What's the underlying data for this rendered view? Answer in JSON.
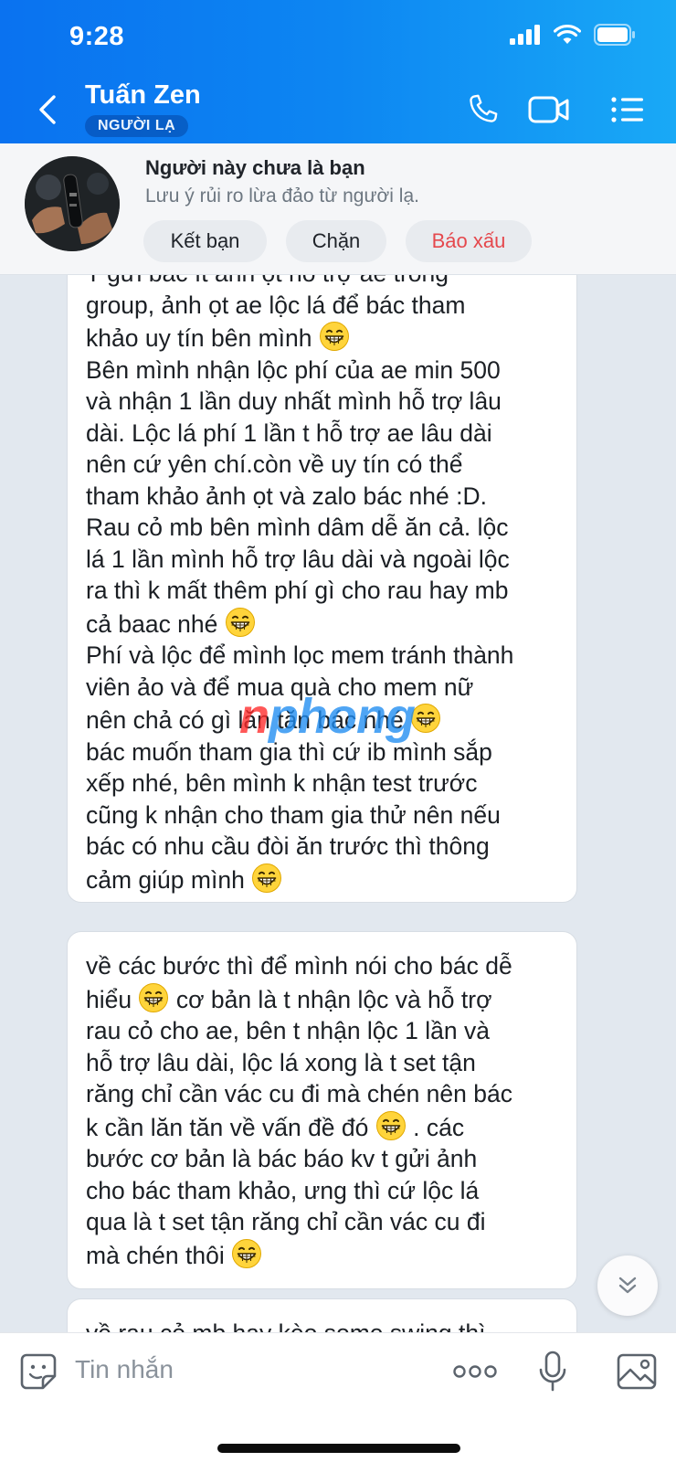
{
  "status_bar": {
    "time": "9:28"
  },
  "header": {
    "title": "Tuấn Zen",
    "tag": "NGƯỜI LẠ",
    "colors": {
      "gradient_start": "#0a72f0",
      "gradient_end": "#19a9f6"
    },
    "icons": [
      "back-chevron-icon",
      "phone-icon",
      "video-call-icon",
      "menu-list-icon"
    ]
  },
  "banner": {
    "title": "Người này chưa là bạn",
    "subtitle": "Lưu ý rủi ro lừa đảo từ người lạ.",
    "buttons": {
      "add_friend": "Kết bạn",
      "block": "Chặn",
      "report": "Báo xấu"
    },
    "report_color": "#e5484d"
  },
  "messages": [
    {
      "lines": [
        "T gửi bác ít ảnh ọt hỗ trợ ae trong",
        "group, ảnh ọt ae lộc lá để bác tham",
        "khảo uy tín bên mình",
        "Bên mình nhận lộc phí của ae min 500",
        "và nhận 1 lần duy nhất mình hỗ trợ lâu",
        "dài. Lộc lá phí 1 lần t hỗ trợ ae lâu dài",
        "nên cứ yên chí.còn về uy tín có thể",
        "tham khảo ảnh ọt và zalo bác nhé :D.",
        "Rau cỏ mb bên mình dâm dễ ăn cả. lộc",
        "lá 1 lần mình hỗ trợ lâu dài và ngoài lộc",
        "ra thì k mất thêm phí gì cho rau hay mb",
        "cả baac nhé",
        "Phí và lộc để mình lọc mem tránh thành",
        "viên ảo và để mua quà cho mem nữ",
        "nên chả có gì lăn tăn bác nhé",
        "bác muốn tham gia thì cứ ib mình sắp",
        "xếp nhé, bên mình k nhận test trước",
        "cũng k nhận cho tham gia thử nên nếu",
        "bác có nhu cầu đòi ăn trước thì thông",
        "cảm giúp mình"
      ]
    },
    {
      "lines": [
        "về các bước thì để mình nói cho bác dễ",
        "hiểu",
        "cơ bản là t nhận lộc và hỗ trợ",
        "rau cỏ cho ae, bên t nhận lộc 1 lần và",
        "hỗ trợ lâu dài, lộc lá xong là t set tận",
        "răng chỉ cần vác cu đi mà chén nên bác",
        "k cần lăn tăn về vấn đề đó",
        ". các",
        "bước cơ bản là bác báo kv t gửi ảnh",
        "cho bác tham khảo, ưng thì cứ lộc lá",
        "qua là t set tận răng chỉ cần vác cu đi",
        "mà chén thôi"
      ]
    },
    {
      "lines": [
        "về rau cỏ mb hay kèo some swing thì"
      ]
    }
  ],
  "watermark": {
    "part1": "n",
    "part2": "phong"
  },
  "input": {
    "placeholder": "Tin nhắn"
  }
}
